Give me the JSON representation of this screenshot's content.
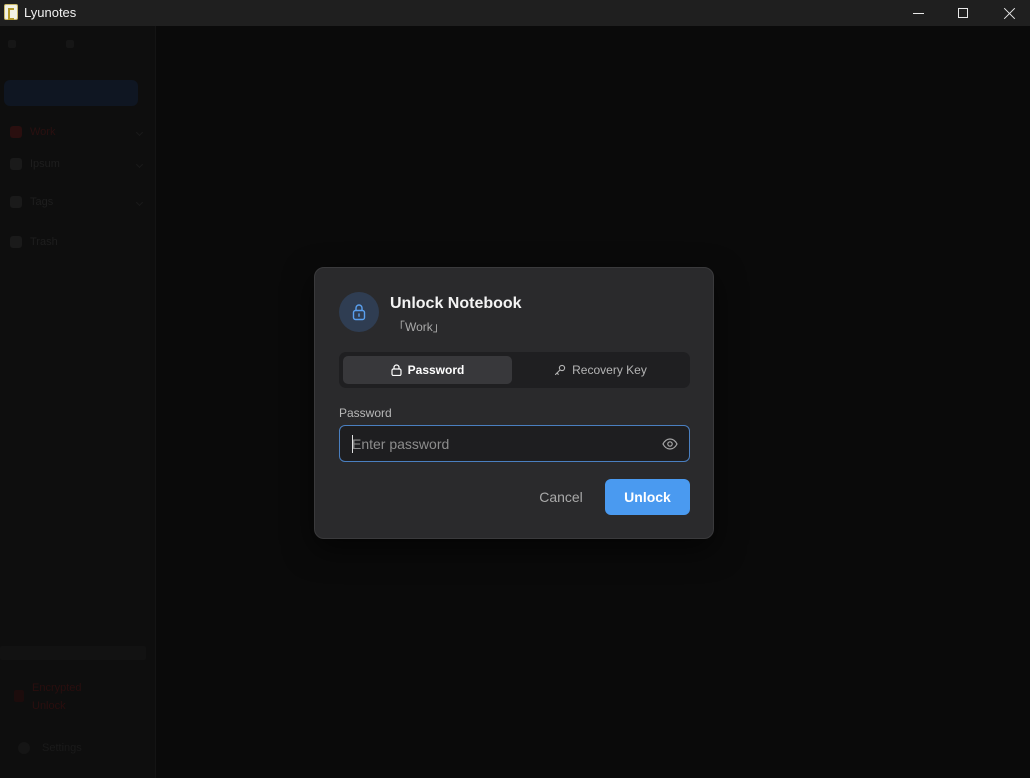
{
  "window": {
    "title": "Lyunotes",
    "icon": "app-logo-icon"
  },
  "window_controls": {
    "minimize": "minimize-icon",
    "maximize": "maximize-icon",
    "close": "close-icon"
  },
  "sidebar": {
    "items": [
      {
        "label": "Work",
        "icon": "notebook-icon"
      },
      {
        "label": "Ipsum",
        "icon": "notebook-icon"
      },
      {
        "label": "Tags",
        "icon": "tag-icon"
      },
      {
        "label": "Trash",
        "icon": "trash-icon"
      }
    ],
    "encrypted_line1": "Encrypted",
    "encrypted_line2": "Unlock",
    "settings": "Settings"
  },
  "dialog": {
    "title": "Unlock Notebook",
    "subtitle": "「Work」",
    "icon": "lock-icon",
    "tabs": [
      {
        "label": "Password",
        "icon": "lock-icon",
        "active": true
      },
      {
        "label": "Recovery Key",
        "icon": "key-icon",
        "active": false
      }
    ],
    "field_label": "Password",
    "password_placeholder": "Enter password",
    "password_value": "",
    "cancel_label": "Cancel",
    "unlock_label": "Unlock"
  },
  "colors": {
    "accent": "#4a9af0",
    "dialog_bg": "#2a2a2c",
    "input_border": "#4a7fc0"
  }
}
